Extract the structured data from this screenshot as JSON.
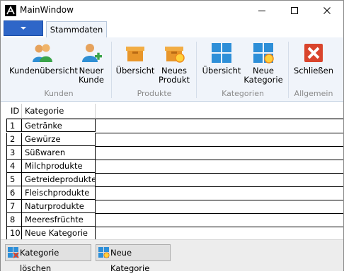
{
  "window": {
    "title": "MainWindow"
  },
  "ribbon": {
    "tab": "Stammdaten",
    "groups": [
      {
        "label": "Kunden",
        "buttons": [
          "Kundenübersicht",
          "Neuer Kunde"
        ]
      },
      {
        "label": "Produkte",
        "buttons": [
          "Übersicht",
          "Neues Produkt"
        ]
      },
      {
        "label": "Kategorien",
        "buttons": [
          "Übersicht",
          "Neue Kategorie"
        ]
      },
      {
        "label": "Allgemein",
        "buttons": [
          "Schließen"
        ]
      }
    ],
    "btn_kundenuebersicht": "Kundenübersicht",
    "btn_neuer_kunde_1": "Neuer",
    "btn_neuer_kunde_2": "Kunde",
    "btn_prod_uebersicht": "Übersicht",
    "btn_neues_produkt_1": "Neues",
    "btn_neues_produkt_2": "Produkt",
    "btn_kat_uebersicht": "Übersicht",
    "btn_neue_kat_1": "Neue",
    "btn_neue_kat_2": "Kategorie",
    "btn_schliessen": "Schließen",
    "group_kunden": "Kunden",
    "group_produkte": "Produkte",
    "group_kategorien": "Kategorien",
    "group_allgemein": "Allgemein"
  },
  "grid": {
    "columns": [
      "ID",
      "Kategorie"
    ],
    "rows": [
      {
        "id": "1",
        "kategorie": "Getränke"
      },
      {
        "id": "2",
        "kategorie": "Gewürze"
      },
      {
        "id": "3",
        "kategorie": "Süßwaren"
      },
      {
        "id": "4",
        "kategorie": "Milchprodukte"
      },
      {
        "id": "5",
        "kategorie": "Getreideprodukte"
      },
      {
        "id": "6",
        "kategorie": "Fleischprodukte"
      },
      {
        "id": "7",
        "kategorie": "Naturprodukte"
      },
      {
        "id": "8",
        "kategorie": "Meeresfrüchte"
      },
      {
        "id": "10",
        "kategorie": "Neue Kategorie"
      }
    ]
  },
  "footer": {
    "delete_label": "Kategorie löschen",
    "new_label": "Neue Kategorie"
  },
  "colors": {
    "app_menu": "#2e66c8",
    "ribbon_bg": "#f0f4fa",
    "close_red": "#d9442c",
    "tile_blue": "#2e8fd8",
    "box_orange": "#e8962a"
  }
}
